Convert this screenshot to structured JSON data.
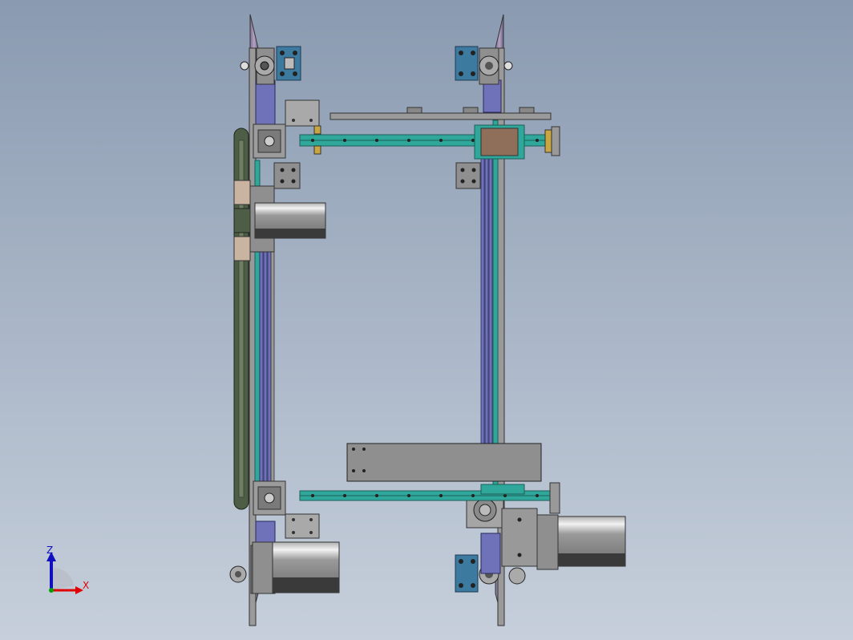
{
  "viewport": {
    "name": "cad-graphics-area",
    "background": "#a2afc2"
  },
  "triad": {
    "x_label": "X",
    "z_label": "Z",
    "colors": {
      "x": "#e00000",
      "y": "#00a000",
      "z": "#1010c0"
    }
  },
  "model": {
    "colors": {
      "frame_gray": "#8f8f8f",
      "frame_dark": "#5d5d5d",
      "rail_teal": "#2fa79a",
      "rail_blue": "#6f72b8",
      "block_blue": "#3d7aa0",
      "plate_purple": "#9a8bb0",
      "belt_green": "#4e5e46",
      "brass": "#c9a640"
    }
  }
}
